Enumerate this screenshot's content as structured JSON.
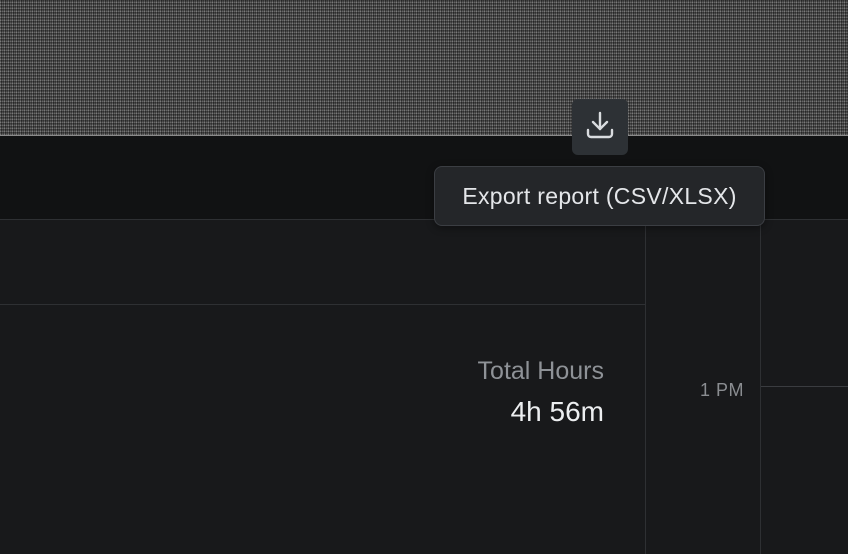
{
  "toolbar": {
    "export_icon": "download-icon",
    "export_tooltip": "Export report (CSV/XLSX)"
  },
  "summary": {
    "total_hours_label": "Total Hours",
    "total_hours_value": "4h 56m"
  },
  "timeline": {
    "hour_label": "1 PM"
  },
  "colors": {
    "background": "#18191b",
    "title_bar": "#111213",
    "button": "#2d3135",
    "tooltip_bg": "#242629",
    "text_primary": "#eceef0",
    "text_muted": "#8e9297"
  }
}
